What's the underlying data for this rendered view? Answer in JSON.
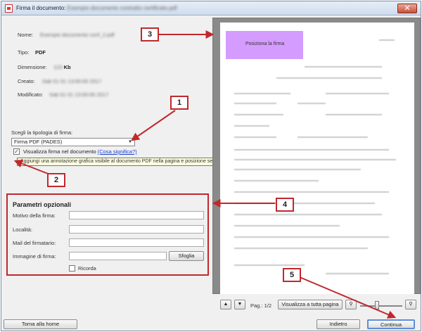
{
  "window": {
    "title_visible": "Firma il documento:",
    "title_blurred": "Esempio documento contratto certificato.pdf",
    "close_glyph": "✕"
  },
  "info": {
    "labels": {
      "name": "Nome:",
      "type": "Tipo:",
      "size": "Dimensione:",
      "created": "Creato:",
      "modified": "Modificato:"
    },
    "type_value": "PDF",
    "name_blurred": "Esempio documento conf_2.pdf",
    "size_blurred": "123",
    "size_unit": "Kb",
    "created_blurred": "Sab 01 01 13:00:00 2017",
    "modified_blurred": "Sab 01 01 13:00:00 2017"
  },
  "signature_type": {
    "label": "Scegli la tipologia di firma:",
    "selected": "Firma PDF (PADES)"
  },
  "visible_signature": {
    "checked": true,
    "label": "Visualizza firma nel documento",
    "link": "(Cosa significa?)",
    "tooltip": "Aggiungi una annotazione grafica visibile al documento PDF nella pagina e posizione selezionata."
  },
  "optional_params": {
    "title": "Parametri opzionali",
    "reason_label": "Motivo della firma:",
    "location_label": "Località:",
    "email_label": "Mail del firmatario:",
    "image_label": "Immagine di firma:",
    "browse_button": "Sfoglia",
    "remember_label": "Ricorda",
    "remember_checked": false
  },
  "preview": {
    "signature_box_label": "Posiziona la firma",
    "page_label": "Pag.: 1/2",
    "full_page_button": "Visualizza a tutta pagina"
  },
  "footer": {
    "home_button": "Torna alla home",
    "back_button": "Indietro",
    "continue_button": "Continua"
  },
  "callouts": [
    "1",
    "2",
    "3",
    "4",
    "5"
  ],
  "colors": {
    "callout_red": "#c0282d",
    "signature_box": "#d59cff",
    "link_blue": "#1a3fd1"
  }
}
